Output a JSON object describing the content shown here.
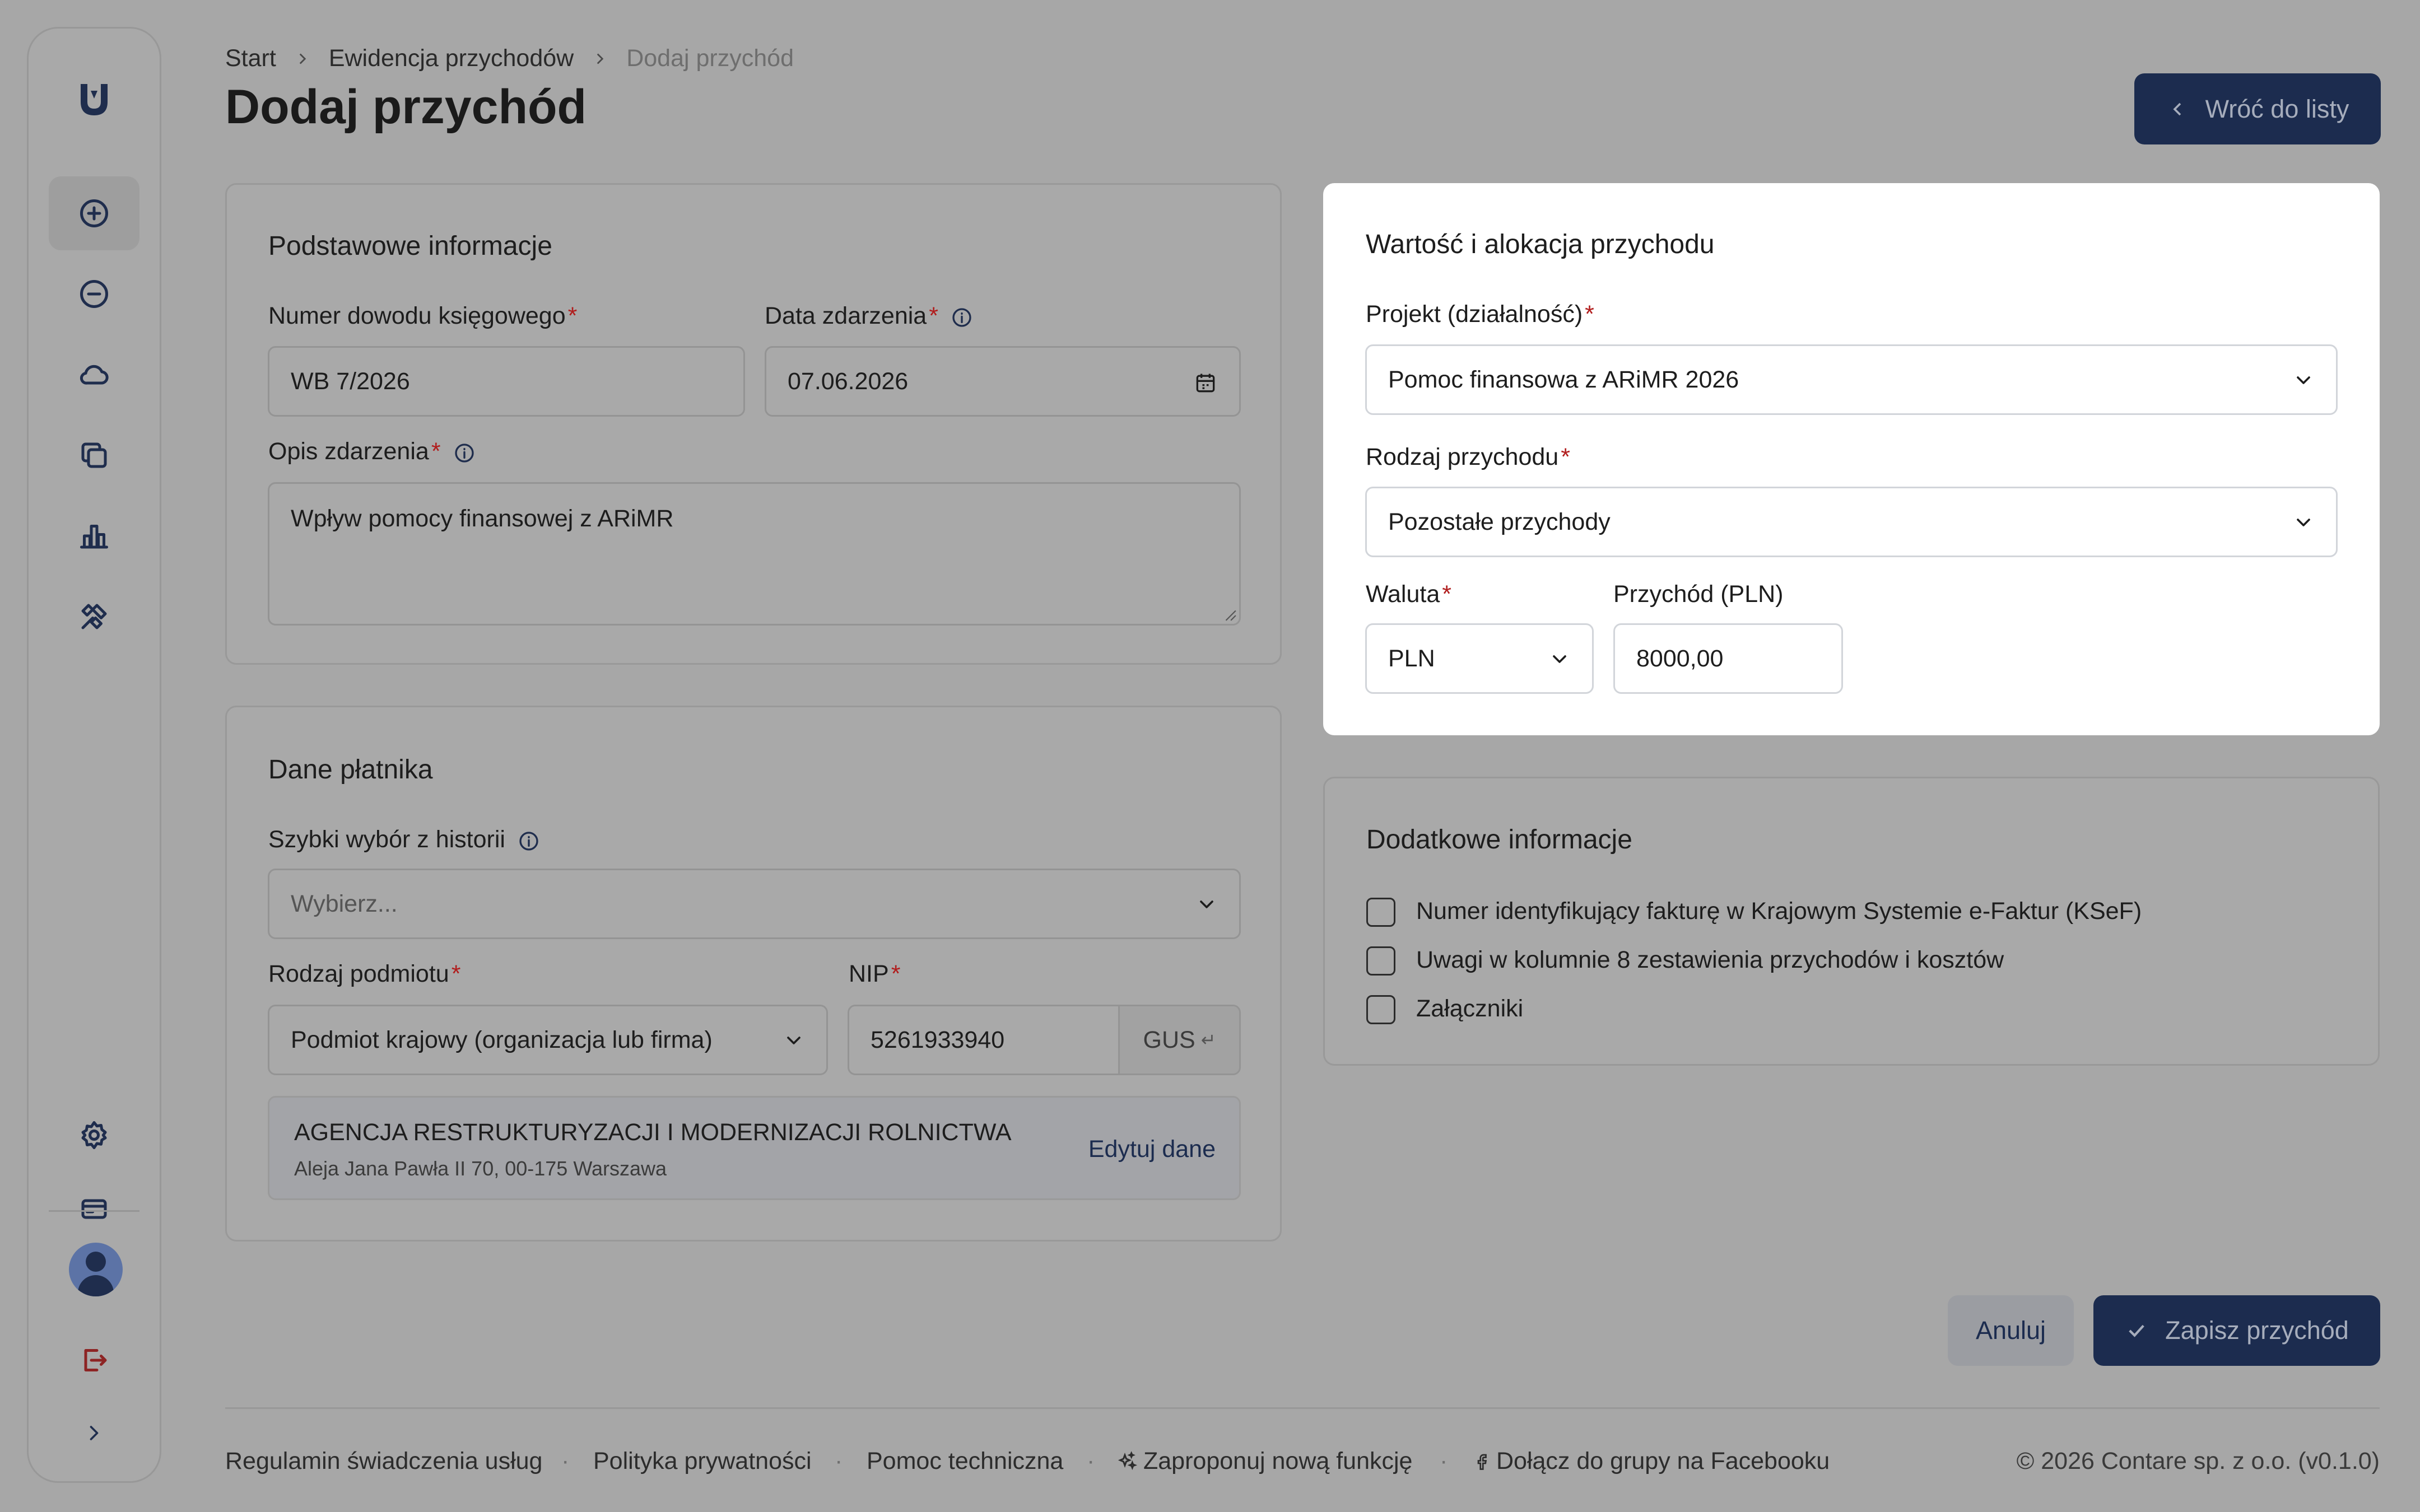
{
  "breadcrumb": {
    "items": [
      "Start",
      "Ewidencja przychodów",
      "Dodaj przychód"
    ]
  },
  "page_title": "Dodaj przychód",
  "back_button": {
    "label": "Wróć do listy"
  },
  "sidebar": {
    "items": [
      "plus-circle-icon",
      "minus-circle-icon",
      "cloud-icon",
      "copy-icon",
      "bar-chart-icon",
      "tools-icon",
      "settings-icon",
      "credit-card-icon",
      "avatar",
      "logout-icon",
      "chevron-right-icon"
    ]
  },
  "basic": {
    "title": "Podstawowe informacje",
    "doc_number_label": "Numer dowodu księgowego",
    "doc_number_value": "WB 7/2026",
    "date_label": "Data zdarzenia",
    "date_value": "07.06.2026",
    "desc_label": "Opis zdarzenia",
    "desc_value": "Wpływ pomocy finansowej z ARiMR"
  },
  "payer": {
    "title": "Dane płatnika",
    "history_label": "Szybki wybór z historii",
    "history_placeholder": "Wybierz...",
    "entity_label": "Rodzaj podmiotu",
    "entity_value": "Podmiot krajowy (organizacja lub firma)",
    "nip_label": "NIP",
    "nip_value": "5261933940",
    "gus_label": "GUS",
    "company_name": "AGENCJA RESTRUKTURYZACJI I MODERNIZACJI ROLNICTWA",
    "company_address": "Aleja Jana Pawła II 70, 00-175 Warszawa",
    "edit_label": "Edytuj dane"
  },
  "value": {
    "title": "Wartość i alokacja przychodu",
    "project_label": "Projekt (działalność)",
    "project_value": "Pomoc finansowa z ARiMR 2026",
    "type_label": "Rodzaj przychodu",
    "type_value": "Pozostałe przychody",
    "currency_label": "Waluta",
    "currency_value": "PLN",
    "amount_label": "Przychód (PLN)",
    "amount_value": "8000,00"
  },
  "extra": {
    "title": "Dodatkowe informacje",
    "options": [
      "Numer identyfikujący fakturę w Krajowym Systemie e-Faktur (KSeF)",
      "Uwagi w kolumnie 8 zestawienia przychodów i kosztów",
      "Załączniki"
    ]
  },
  "actions": {
    "cancel": "Anuluj",
    "save": "Zapisz przychód"
  },
  "footer": {
    "links": [
      "Regulamin świadczenia usług",
      "Polityka prywatności",
      "Pomoc techniczna",
      "Zaproponuj nową funkcję",
      "Dołącz do grupy na Facebooku"
    ],
    "copyright": "© 2026 Contare sp. z o.o. (v0.1.0)"
  },
  "colors": {
    "primary": "#1c2c4f",
    "required": "#b11d1d",
    "overlay": "#a7a7a7"
  }
}
